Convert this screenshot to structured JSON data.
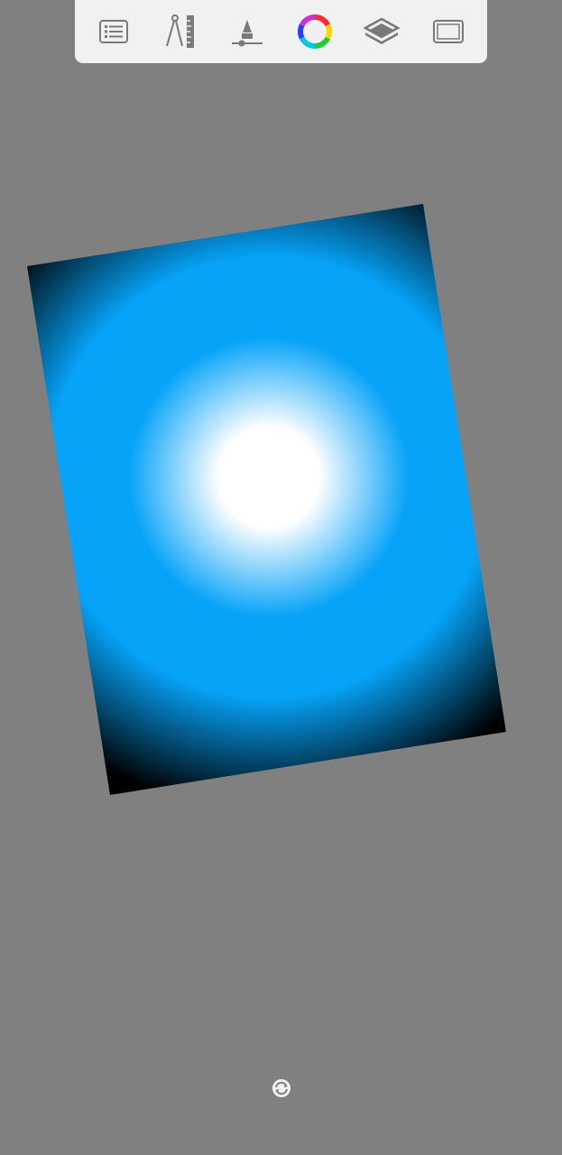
{
  "app": {
    "background_color": "#808080"
  },
  "toolbar": {
    "background_color": "#f1f1f1",
    "icon_color": "#7a7a7a",
    "tools": [
      {
        "name": "list-icon"
      },
      {
        "name": "ruler-compass-icon"
      },
      {
        "name": "brush-size-icon"
      },
      {
        "name": "color-wheel-icon"
      },
      {
        "name": "layers-icon"
      },
      {
        "name": "fullscreen-frame-icon"
      }
    ]
  },
  "canvas": {
    "rotation_deg": -10,
    "gradient": {
      "type": "radial",
      "center_color": "#ffffff",
      "mid_color": "#06a3f8",
      "outer_color": "#000000"
    }
  },
  "rotate_control": {
    "icon": "rotate-reset-icon",
    "color": "#f2f2f2"
  }
}
